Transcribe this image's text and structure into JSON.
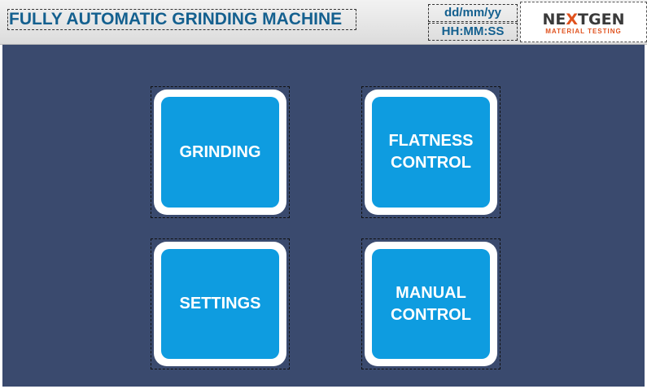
{
  "header": {
    "title": "FULLY AUTOMATIC GRINDING MACHINE",
    "date_format": "dd/mm/yy",
    "time_format": "HH:MM:SS"
  },
  "logo": {
    "main_left": "NE",
    "main_x": "X",
    "main_right": "TGEN",
    "sub": "MATERIAL TESTING"
  },
  "buttons": {
    "grinding": "GRINDING",
    "flatness_control": "FLATNESS\nCONTROL",
    "settings": "SETTINGS",
    "manual_control": "MANUAL\nCONTROL"
  },
  "colors": {
    "background": "#3a4a6e",
    "button_fill": "#0e9ce0",
    "title_text": "#14608f",
    "logo_accent": "#e0521e"
  }
}
